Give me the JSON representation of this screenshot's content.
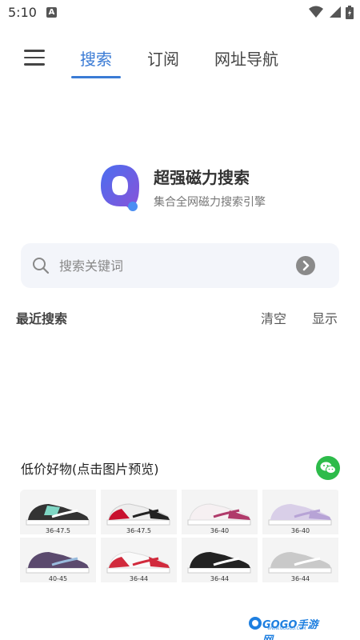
{
  "status_bar": {
    "time": "5:10",
    "notification": "A",
    "icons": [
      "wifi-icon",
      "signal-icon",
      "battery-icon"
    ]
  },
  "nav": {
    "tabs": [
      {
        "label": "搜索",
        "active": true
      },
      {
        "label": "订阅",
        "active": false
      },
      {
        "label": "网址导航",
        "active": false
      }
    ]
  },
  "brand": {
    "name": "超强磁力搜索",
    "tagline": "集合全网磁力搜索引擎"
  },
  "search": {
    "placeholder": "搜索关键词",
    "value": ""
  },
  "recent": {
    "title": "最近搜索",
    "clear_label": "清空",
    "show_label": "显示"
  },
  "deals": {
    "title": "低价好物(点击图片预览)",
    "products": [
      {
        "size": "36-47.5",
        "accent": "#7fd6c4"
      },
      {
        "size": "36-47.5",
        "accent": "#c8102e"
      },
      {
        "size": "36-40",
        "accent": "#b03a6a"
      },
      {
        "size": "36-40",
        "accent": "#b7a3d6"
      },
      {
        "size": "40-45",
        "accent": "#5b4a6e"
      },
      {
        "size": "36-44",
        "accent": "#d12a3c"
      },
      {
        "size": "36-44",
        "accent": "#222222"
      },
      {
        "size": "36-44",
        "accent": "#a8a8a8"
      }
    ]
  },
  "watermark": {
    "text": "GOGO手游网",
    "sub": "WWW.GOGUD.COM"
  },
  "colors": {
    "accent": "#3a7bd5",
    "search_bg": "#f3f5fa",
    "wechat": "#2dbb4a"
  }
}
